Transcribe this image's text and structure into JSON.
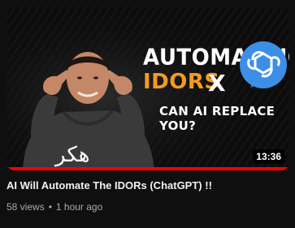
{
  "thumbnail": {
    "line1": "AUTOMATING",
    "line2": "IDORS",
    "x": "X",
    "subtitle": "CAN AI REPLACE YOU?",
    "shirt_text": "هكر",
    "duration": "13:36",
    "watch_progress": 1.0,
    "accent_color": "#f29c1f",
    "logo_icon": "chatgpt-logo-icon"
  },
  "video": {
    "title": "AI Will Automate The IDORs (ChatGPT) !!",
    "views": "58 views",
    "age": "1 hour ago",
    "separator": "•"
  }
}
